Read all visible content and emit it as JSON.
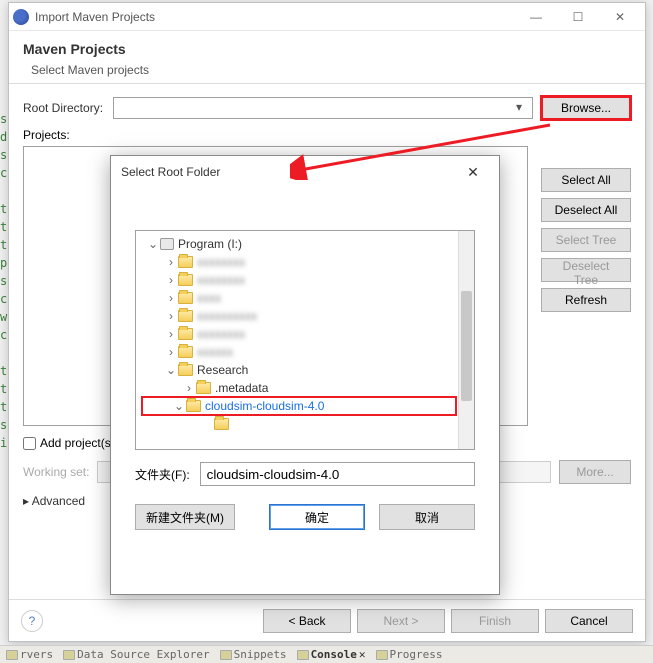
{
  "window": {
    "title": "Import Maven Projects",
    "banner_title": "Maven Projects",
    "banner_sub": "Select Maven projects"
  },
  "fields": {
    "root_dir_label": "Root Directory:",
    "projects_label": "Projects:",
    "add_projects_label": "Add project(s",
    "working_set_label": "Working set:",
    "advanced_label": "Advanced"
  },
  "buttons": {
    "browse": "Browse...",
    "select_all": "Select All",
    "deselect_all": "Deselect All",
    "select_tree": "Select Tree",
    "deselect_tree": "Deselect Tree",
    "refresh": "Refresh",
    "more": "More...",
    "back": "< Back",
    "next": "Next >",
    "finish": "Finish",
    "cancel": "Cancel"
  },
  "sub_dialog": {
    "title": "Select Root Folder",
    "folder_label": "文件夹(F):",
    "folder_value": "cloudsim-cloudsim-4.0",
    "new_folder": "新建文件夹(M)",
    "ok": "确定",
    "cancel": "取消",
    "tree": {
      "root": "Program (I:)",
      "research": "Research",
      "metadata": ".metadata",
      "selected": "cloudsim-cloudsim-4.0"
    }
  },
  "statusbar": {
    "servers": "rvers",
    "dse": "Data Source Explorer",
    "snippets": "Snippets",
    "console": "Console",
    "progress": "Progress"
  }
}
